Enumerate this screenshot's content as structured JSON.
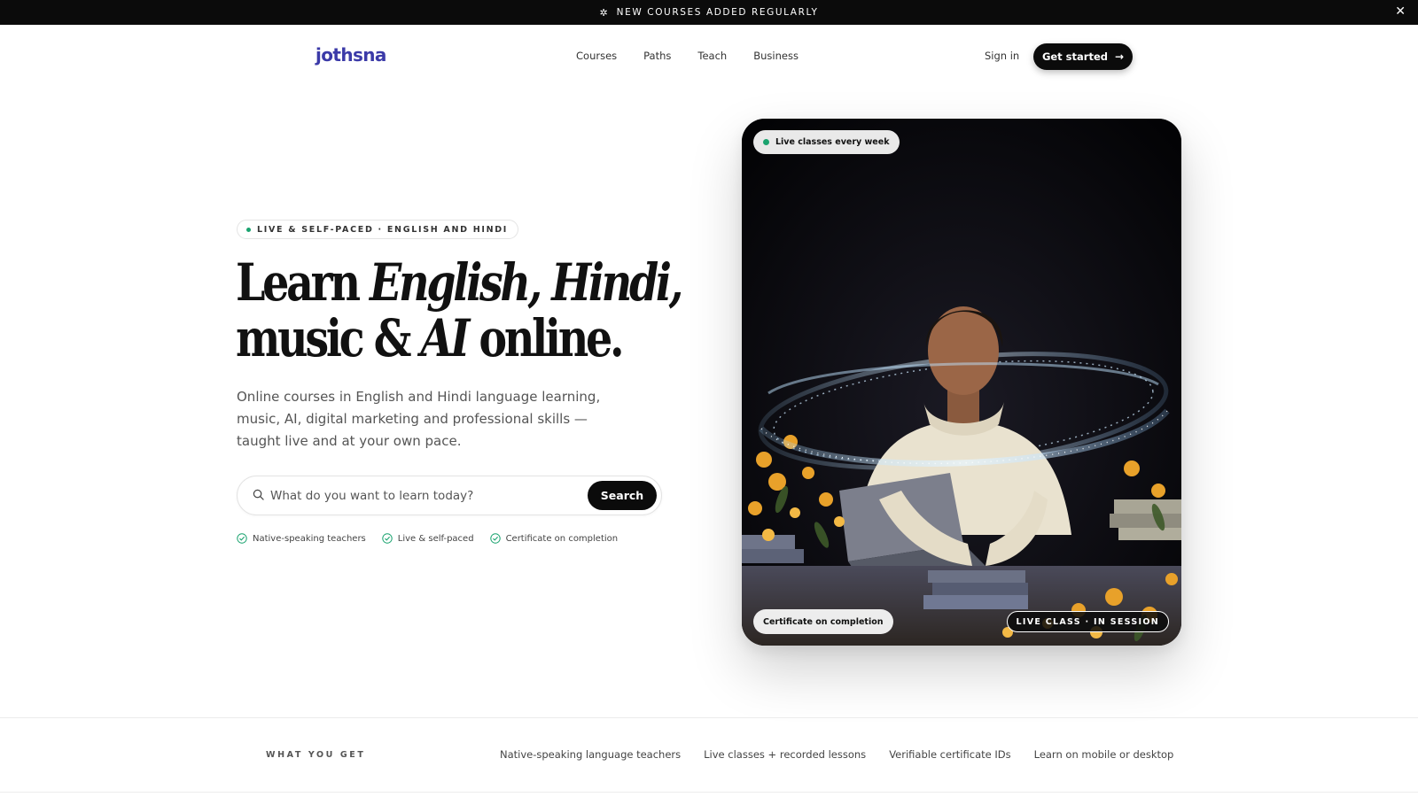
{
  "announcement": {
    "text": "NEW COURSES ADDED REGULARLY",
    "icon": "sparkle-icon",
    "close_icon": "close-icon"
  },
  "nav": {
    "logo": "jothsna",
    "links": [
      "Courses",
      "Paths",
      "Teach",
      "Business"
    ],
    "sign_in": "Sign in",
    "cta": "Get started"
  },
  "hero": {
    "eyebrow": "LIVE & SELF-PACED · ENGLISH AND HINDI",
    "headline": {
      "w1": "Learn ",
      "w2": "English, Hindi,",
      "w3": "music & ",
      "w4": "AI",
      "w5": " online."
    },
    "subcopy": "Online courses in English and Hindi language learning, music, AI, digital marketing and professional skills — taught live and at your own pace.",
    "search": {
      "placeholder": "What do you want to learn today?",
      "button": "Search"
    },
    "checks": [
      "Native-speaking teachers",
      "Live & self-paced",
      "Certificate on completion"
    ],
    "card": {
      "pill_top": "Live classes every week",
      "pill_bottom_left": "Certificate on completion",
      "pill_bottom_right": "LIVE CLASS · IN SESSION"
    }
  },
  "features": {
    "label": "WHAT YOU GET",
    "items": [
      "Native-speaking language teachers",
      "Live classes + recorded lessons",
      "Verifiable certificate IDs",
      "Learn on mobile or desktop"
    ]
  },
  "colors": {
    "brand": "#3b3aa8",
    "accent_green": "#1aa36f",
    "dark": "#0b0b0b"
  }
}
